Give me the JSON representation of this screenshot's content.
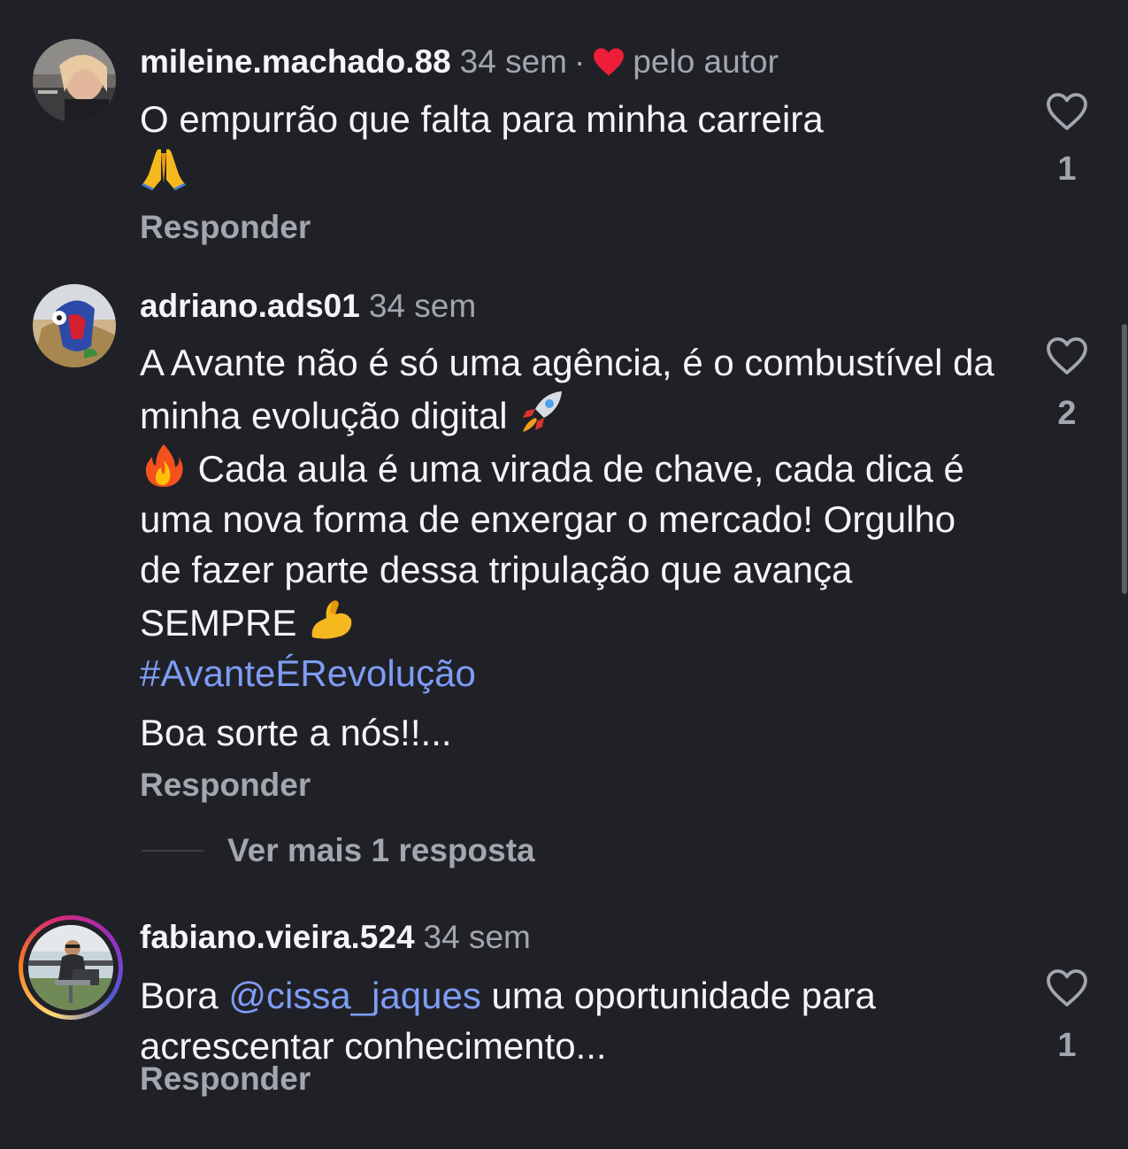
{
  "comments": [
    {
      "username": "mileine.machado.88",
      "time": "34 sem",
      "separator": "·",
      "liked_by_author": "pelo autor",
      "text": "O empurrão que falta para minha carreira",
      "emoji": "folded-hands",
      "reply_label": "Responder",
      "like_count": "1"
    },
    {
      "username": "adriano.ads01",
      "time": "34 sem",
      "text_part1": "A Avante não é só uma agência, é o combustível da minha evolução digital",
      "text_part2": "Cada aula é uma virada de chave, cada dica é uma nova forma de enxergar o mercado! Orgulho de fazer parte dessa tripulação que avança SEMPRE",
      "hashtag": "#AvanteÉRevolução",
      "text_part3": "Boa sorte a nós!!...",
      "reply_label": "Responder",
      "like_count": "2",
      "more_replies": "Ver mais 1 resposta"
    },
    {
      "username": "fabiano.vieira.524",
      "time": "34 sem",
      "text_before": "Bora",
      "mention": "@cissa_jaques",
      "text_after": "uma oportunidade para acrescentar conhecimento...",
      "reply_label": "Responder",
      "like_count": "1",
      "has_story_ring": true
    }
  ],
  "colors": {
    "background": "#202127",
    "primary_text": "#f4f5f7",
    "secondary_text": "#a3a6ae",
    "link": "#7f9cf5",
    "heart_red": "#ee1d3a"
  },
  "icons": {
    "like": "heart-outline-icon",
    "author_like": "heart-filled-icon"
  }
}
